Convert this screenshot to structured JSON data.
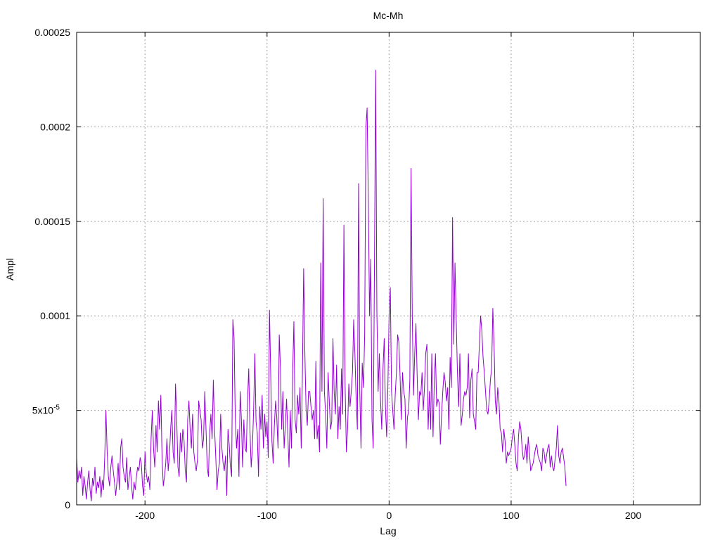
{
  "chart_data": {
    "type": "line",
    "title": "Mc-Mh",
    "xlabel": "Lag",
    "ylabel": "Ampl",
    "xlim": [
      -256,
      255
    ],
    "ylim": [
      0,
      0.00025
    ],
    "grid": true,
    "x_ticks": [
      {
        "value": -200,
        "label": "-200"
      },
      {
        "value": -100,
        "label": "-100"
      },
      {
        "value": 0,
        "label": "0"
      },
      {
        "value": 100,
        "label": "100"
      },
      {
        "value": 200,
        "label": "200"
      }
    ],
    "y_ticks": [
      {
        "value": 0,
        "label": "0"
      },
      {
        "value": 5e-05,
        "label": "5x10",
        "sup": "-5"
      },
      {
        "value": 0.0001,
        "label": "0.0001"
      },
      {
        "value": 0.00015,
        "label": "0.00015"
      },
      {
        "value": 0.0002,
        "label": "0.0002"
      },
      {
        "value": 0.00025,
        "label": "0.00025"
      }
    ],
    "series": [
      {
        "color": "#9400d3",
        "x_start": -256,
        "x_step": 1,
        "y_unit": 1e-06,
        "values": [
          25,
          12,
          18,
          14,
          20,
          5,
          15,
          10,
          3,
          12,
          18,
          8,
          2,
          14,
          10,
          20,
          6,
          12,
          9,
          15,
          4,
          13,
          8,
          25,
          50,
          28,
          15,
          10,
          20,
          26,
          18,
          12,
          5,
          12,
          22,
          8,
          30,
          35,
          20,
          15,
          12,
          25,
          8,
          14,
          20,
          10,
          3,
          12,
          8,
          15,
          20,
          18,
          25,
          22,
          10,
          5,
          28,
          17,
          12,
          15,
          8,
          35,
          50,
          30,
          20,
          42,
          28,
          55,
          40,
          58,
          25,
          10,
          15,
          22,
          35,
          18,
          26,
          40,
          50,
          28,
          22,
          64,
          45,
          20,
          15,
          38,
          28,
          40,
          34,
          18,
          12,
          45,
          55,
          40,
          30,
          48,
          28,
          22,
          18,
          24,
          55,
          50,
          45,
          30,
          35,
          60,
          40,
          20,
          15,
          38,
          48,
          35,
          66,
          40,
          25,
          8,
          18,
          22,
          48,
          30,
          22,
          18,
          26,
          5,
          40,
          32,
          20,
          15,
          98,
          88,
          45,
          30,
          40,
          15,
          60,
          45,
          20,
          45,
          30,
          28,
          55,
          72,
          40,
          20,
          30,
          50,
          80,
          44,
          38,
          15,
          52,
          40,
          58,
          30,
          48,
          36,
          44,
          25,
          103,
          70,
          34,
          22,
          42,
          55,
          46,
          30,
          90,
          72,
          40,
          60,
          30,
          42,
          56,
          38,
          20,
          50,
          30,
          70,
          97,
          45,
          38,
          58,
          48,
          62,
          30,
          70,
          125,
          80,
          50,
          42,
          60,
          60,
          52,
          45,
          50,
          35,
          76,
          35,
          42,
          28,
          128,
          60,
          162,
          60,
          48,
          30,
          70,
          55,
          40,
          44,
          88,
          60,
          48,
          74,
          35,
          52,
          40,
          72,
          48,
          148,
          62,
          28,
          40,
          64,
          52,
          60,
          70,
          98,
          80,
          56,
          40,
          170,
          60,
          30,
          75,
          62,
          90,
          200,
          210,
          160,
          100,
          130,
          45,
          30,
          125,
          230,
          102,
          60,
          80,
          55,
          40,
          72,
          88,
          52,
          36,
          62,
          100,
          115,
          60,
          50,
          40,
          58,
          70,
          90,
          86,
          68,
          45,
          70,
          60,
          56,
          30,
          46,
          50,
          66,
          178,
          100,
          58,
          80,
          96,
          68,
          45,
          60,
          58,
          70,
          50,
          62,
          80,
          85,
          40,
          60,
          40,
          80,
          36,
          64,
          80,
          52,
          56,
          54,
          32,
          48,
          60,
          70,
          65,
          55,
          62,
          40,
          78,
          62,
          152,
          85,
          128,
          98,
          70,
          52,
          80,
          42,
          48,
          56,
          60,
          58,
          62,
          80,
          46,
          66,
          72,
          48,
          44,
          40,
          70,
          70,
          85,
          100,
          92,
          78,
          70,
          60,
          50,
          48,
          55,
          66,
          72,
          104,
          85,
          55,
          48,
          62,
          55,
          40,
          38,
          28,
          40,
          34,
          22,
          28,
          26,
          28,
          30,
          36,
          40,
          32,
          22,
          18,
          36,
          44,
          40,
          30,
          24,
          26,
          32,
          22,
          36,
          28,
          18,
          20,
          22,
          26,
          30,
          32,
          26,
          24,
          22,
          18,
          30,
          28,
          22,
          26,
          30,
          32,
          20,
          26,
          20,
          18,
          24,
          30,
          42,
          26,
          22,
          28,
          30,
          25,
          20,
          10
        ]
      }
    ]
  }
}
